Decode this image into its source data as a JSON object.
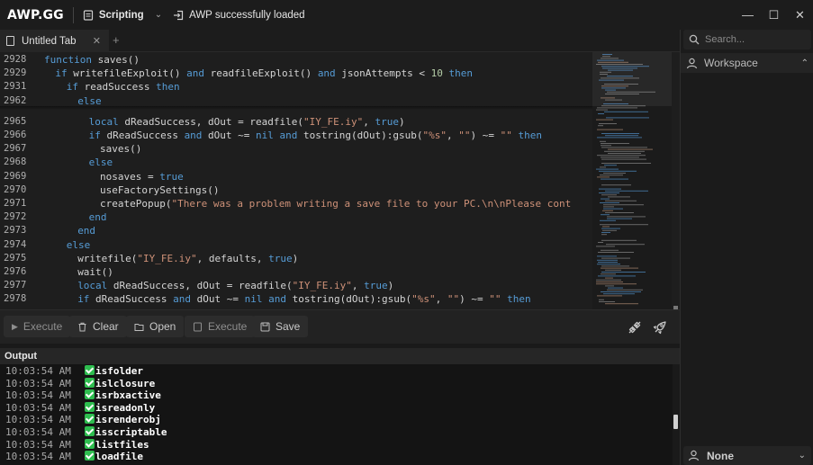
{
  "titlebar": {
    "brand": "AWP.GG",
    "mode_label": "Scripting",
    "status_text": "AWP successfully loaded",
    "min_glyph": "—",
    "max_glyph": "☐",
    "close_glyph": "✕"
  },
  "tabs": {
    "items": [
      {
        "label": "Untitled Tab",
        "close_glyph": "✕"
      }
    ],
    "add_glyph": "+"
  },
  "editor": {
    "lines": [
      {
        "n": "2928",
        "indent": 0,
        "tokens": [
          [
            "kw",
            "function"
          ],
          [
            "t",
            " saves()"
          ]
        ]
      },
      {
        "n": "2929",
        "indent": 2,
        "tokens": [
          [
            "kw",
            "if"
          ],
          [
            "t",
            " writefileExploit() "
          ],
          [
            "kw",
            "and"
          ],
          [
            "t",
            " readfileExploit() "
          ],
          [
            "kw",
            "and"
          ],
          [
            "t",
            " jsonAttempts < "
          ],
          [
            "num",
            "10"
          ],
          [
            "t",
            " "
          ],
          [
            "kw",
            "then"
          ]
        ]
      },
      {
        "n": "2931",
        "indent": 4,
        "tokens": [
          [
            "kw",
            "if"
          ],
          [
            "t",
            " readSuccess "
          ],
          [
            "kw",
            "then"
          ]
        ]
      },
      {
        "n": "2962",
        "indent": 6,
        "tokens": [
          [
            "kw",
            "else"
          ]
        ]
      },
      {
        "n": "2965",
        "indent": 8,
        "tokens": [
          [
            "kw",
            "local"
          ],
          [
            "t",
            " dReadSuccess, dOut = readfile("
          ],
          [
            "str",
            "\"IY_FE.iy\""
          ],
          [
            "t",
            ", "
          ],
          [
            "kw",
            "true"
          ],
          [
            "t",
            ")"
          ]
        ]
      },
      {
        "n": "2966",
        "indent": 8,
        "tokens": [
          [
            "kw",
            "if"
          ],
          [
            "t",
            " dReadSuccess "
          ],
          [
            "kw",
            "and"
          ],
          [
            "t",
            " dOut ~= "
          ],
          [
            "kw",
            "nil"
          ],
          [
            "t",
            " "
          ],
          [
            "kw",
            "and"
          ],
          [
            "t",
            " tostring(dOut):gsub("
          ],
          [
            "str",
            "\"%s\""
          ],
          [
            "t",
            ", "
          ],
          [
            "str",
            "\"\""
          ],
          [
            "t",
            ") ~= "
          ],
          [
            "str",
            "\"\""
          ],
          [
            "t",
            " "
          ],
          [
            "kw",
            "then"
          ]
        ]
      },
      {
        "n": "2967",
        "indent": 10,
        "tokens": [
          [
            "t",
            "saves()"
          ]
        ]
      },
      {
        "n": "2968",
        "indent": 8,
        "tokens": [
          [
            "kw",
            "else"
          ]
        ]
      },
      {
        "n": "2969",
        "indent": 10,
        "tokens": [
          [
            "t",
            "nosaves = "
          ],
          [
            "kw",
            "true"
          ]
        ]
      },
      {
        "n": "2970",
        "indent": 10,
        "tokens": [
          [
            "t",
            "useFactorySettings()"
          ]
        ]
      },
      {
        "n": "2971",
        "indent": 10,
        "tokens": [
          [
            "t",
            "createPopup("
          ],
          [
            "str",
            "\"There was a problem writing a save file to your PC.\\n\\nPlease cont"
          ]
        ]
      },
      {
        "n": "2972",
        "indent": 8,
        "tokens": [
          [
            "kw",
            "end"
          ]
        ]
      },
      {
        "n": "2973",
        "indent": 6,
        "tokens": [
          [
            "kw",
            "end"
          ]
        ]
      },
      {
        "n": "2974",
        "indent": 4,
        "tokens": [
          [
            "kw",
            "else"
          ]
        ]
      },
      {
        "n": "2975",
        "indent": 6,
        "tokens": [
          [
            "t",
            "writefile("
          ],
          [
            "str",
            "\"IY_FE.iy\""
          ],
          [
            "t",
            ", defaults, "
          ],
          [
            "kw",
            "true"
          ],
          [
            "t",
            ")"
          ]
        ]
      },
      {
        "n": "2976",
        "indent": 6,
        "tokens": [
          [
            "t",
            "wait()"
          ]
        ]
      },
      {
        "n": "2977",
        "indent": 6,
        "tokens": [
          [
            "kw",
            "local"
          ],
          [
            "t",
            " dReadSuccess, dOut = readfile("
          ],
          [
            "str",
            "\"IY_FE.iy\""
          ],
          [
            "t",
            ", "
          ],
          [
            "kw",
            "true"
          ],
          [
            "t",
            ")"
          ]
        ]
      },
      {
        "n": "2978",
        "indent": 6,
        "tokens": [
          [
            "kw",
            "if"
          ],
          [
            "t",
            " dReadSuccess "
          ],
          [
            "kw",
            "and"
          ],
          [
            "t",
            " dOut ~= "
          ],
          [
            "kw",
            "nil"
          ],
          [
            "t",
            " "
          ],
          [
            "kw",
            "and"
          ],
          [
            "t",
            " tostring(dOut):gsub("
          ],
          [
            "str",
            "\"%s\""
          ],
          [
            "t",
            ", "
          ],
          [
            "str",
            "\"\""
          ],
          [
            "t",
            ") ~= "
          ],
          [
            "str",
            "\"\""
          ],
          [
            "t",
            " "
          ],
          [
            "kw",
            "then"
          ]
        ]
      }
    ]
  },
  "actions": {
    "execute_left": "Execute",
    "clear": "Clear",
    "open": "Open",
    "execute": "Execute",
    "save": "Save"
  },
  "output": {
    "title": "Output",
    "rows": [
      {
        "time": "10:03:54 AM",
        "msg": "isfolder"
      },
      {
        "time": "10:03:54 AM",
        "msg": "islclosure"
      },
      {
        "time": "10:03:54 AM",
        "msg": "isrbxactive"
      },
      {
        "time": "10:03:54 AM",
        "msg": "isreadonly"
      },
      {
        "time": "10:03:54 AM",
        "msg": "isrenderobj"
      },
      {
        "time": "10:03:54 AM",
        "msg": "isscriptable"
      },
      {
        "time": "10:03:54 AM",
        "msg": "listfiles"
      },
      {
        "time": "10:03:54 AM",
        "msg": "loadfile"
      }
    ]
  },
  "sidebar": {
    "search_placeholder": "Search...",
    "workspace_label": "Workspace",
    "none_label": "None"
  },
  "colors": {
    "keyword": "#569cd6",
    "string": "#ce9178",
    "number": "#b5cea8",
    "success": "#2ebd4f"
  }
}
